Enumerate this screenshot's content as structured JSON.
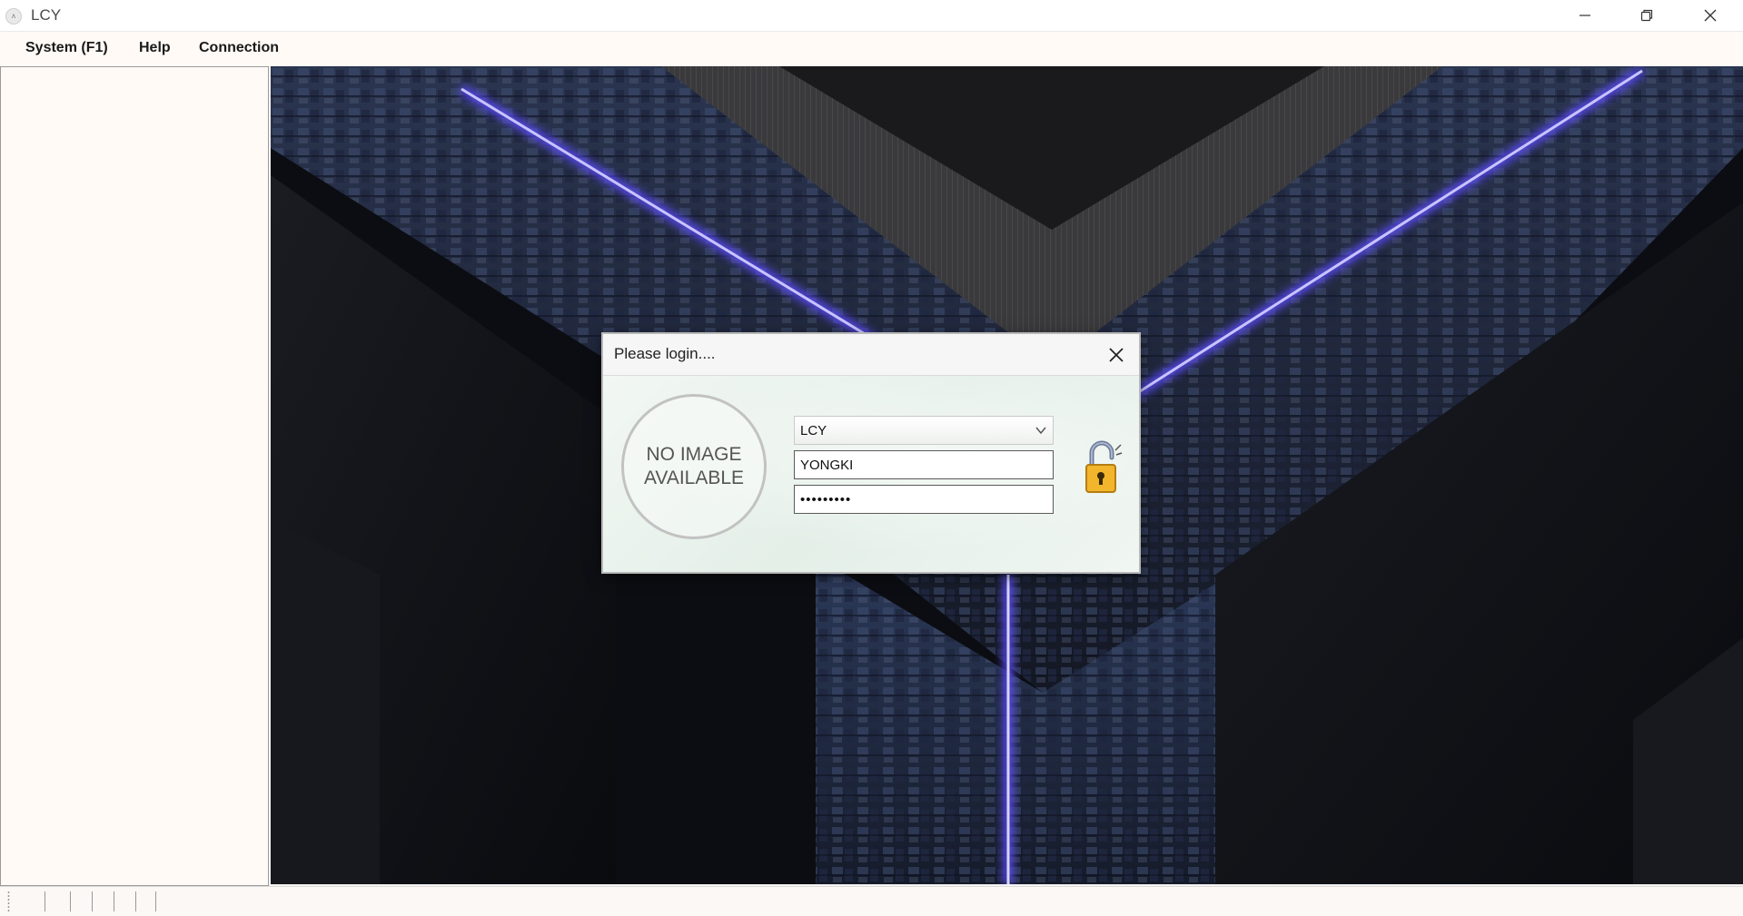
{
  "window": {
    "title": "LCY",
    "icon": "app-icon",
    "controls": [
      "minimize-icon",
      "restore-icon",
      "close-icon"
    ]
  },
  "menu": {
    "items": [
      "System (F1)",
      "Help",
      "Connection"
    ]
  },
  "dialog": {
    "title": "Please login....",
    "avatar_text": "NO IMAGE\nAVAILABLE",
    "database_select": "LCY",
    "username": "YONGKI",
    "password": "•••••••••",
    "lock_icon": "unlocked-padlock-icon",
    "lock_color": "#f2b52c"
  },
  "statusbar": {
    "segments": 5
  }
}
